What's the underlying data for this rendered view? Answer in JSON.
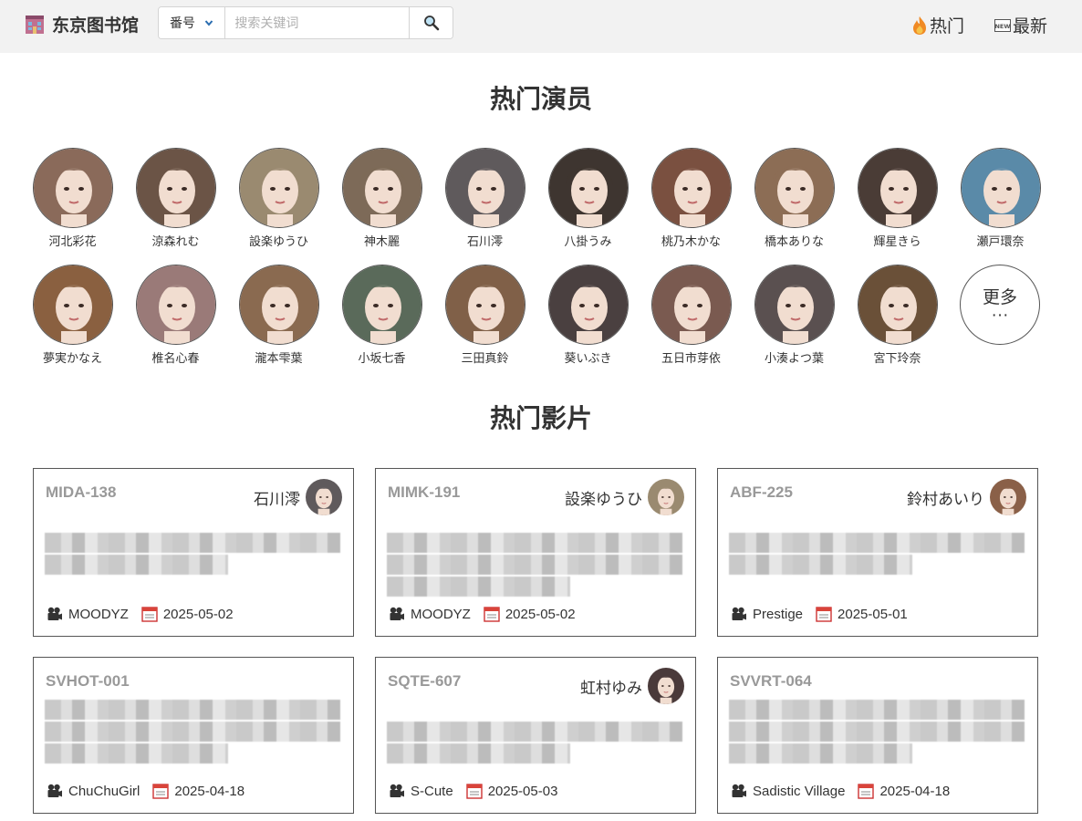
{
  "header": {
    "site_title": "东京图书馆",
    "search": {
      "selected_option": "番号",
      "placeholder": "搜索关键词"
    },
    "nav": {
      "hot": "热门",
      "latest": "最新"
    }
  },
  "actors_section": {
    "title": "热门演员",
    "actors": [
      {
        "name": "河北彩花",
        "color": "#8a6a5a"
      },
      {
        "name": "涼森れむ",
        "color": "#6b5446"
      },
      {
        "name": "設楽ゆうひ",
        "color": "#9a8a70"
      },
      {
        "name": "神木麗",
        "color": "#7d6a58"
      },
      {
        "name": "石川澪",
        "color": "#5f5a5c"
      },
      {
        "name": "八掛うみ",
        "color": "#3e3530"
      },
      {
        "name": "桃乃木かな",
        "color": "#7a5040"
      },
      {
        "name": "橋本ありな",
        "color": "#8c6d55"
      },
      {
        "name": "輝星きら",
        "color": "#4a3c36"
      },
      {
        "name": "瀬戸環奈",
        "color": "#5a8aa8"
      },
      {
        "name": "夢実かなえ",
        "color": "#8a6040"
      },
      {
        "name": "椎名心春",
        "color": "#9a7a78"
      },
      {
        "name": "瀧本雫葉",
        "color": "#8a6a50"
      },
      {
        "name": "小坂七香",
        "color": "#5a6a5a"
      },
      {
        "name": "三田真鈴",
        "color": "#806048"
      },
      {
        "name": "葵いぶき",
        "color": "#4a4040"
      },
      {
        "name": "五日市芽依",
        "color": "#7a5a50"
      },
      {
        "name": "小湊よつ葉",
        "color": "#5a5050"
      },
      {
        "name": "宮下玲奈",
        "color": "#6a5038"
      }
    ],
    "more": {
      "label": "更多",
      "dots": "···"
    }
  },
  "films_section": {
    "title": "热门影片",
    "films": [
      {
        "code": "MIDA-138",
        "actor": "石川澪",
        "actor_color": "#5f5a5c",
        "studio": "MOODYZ",
        "date": "2025-05-02",
        "blur_rows": 2
      },
      {
        "code": "MIMK-191",
        "actor": "設楽ゆうひ",
        "actor_color": "#9a8a70",
        "studio": "MOODYZ",
        "date": "2025-05-02",
        "blur_rows": 3
      },
      {
        "code": "ABF-225",
        "actor": "鈴村あいり",
        "actor_color": "#8a6048",
        "studio": "Prestige",
        "date": "2025-05-01",
        "blur_rows": 2
      },
      {
        "code": "SVHOT-001",
        "actor": "",
        "actor_color": "",
        "studio": "ChuChuGirl",
        "date": "2025-04-18",
        "blur_rows": 3
      },
      {
        "code": "SQTE-607",
        "actor": "虹村ゆみ",
        "actor_color": "#4a3a3a",
        "studio": "S-Cute",
        "date": "2025-05-03",
        "blur_rows": 2
      },
      {
        "code": "SVVRT-064",
        "actor": "",
        "actor_color": "",
        "studio": "Sadistic Village",
        "date": "2025-04-18",
        "blur_rows": 3
      }
    ]
  },
  "icons": {
    "brand": "library-icon",
    "search_button": "search-icon",
    "hot": "fire-icon",
    "latest": "new-badge-icon",
    "studio": "film-camera-icon",
    "date": "calendar-icon"
  }
}
